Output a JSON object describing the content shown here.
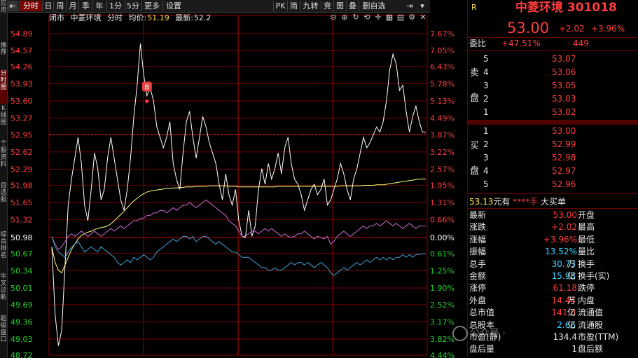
{
  "sidebar": {
    "tabs": [
      "应用",
      "推荐",
      "分时图",
      "K线图",
      "个股资料",
      "自选股",
      "综合排名",
      "牛叉诊断",
      "超级盘口"
    ]
  },
  "toolbar": {
    "left_icon": "back-arrow-icon",
    "periods": [
      "分时",
      "日",
      "周",
      "月",
      "季",
      "年",
      "1分",
      "5分",
      "更多",
      "设置"
    ],
    "active_period": "分时",
    "tools": [
      "PK",
      "简",
      "九转",
      "竞",
      "图",
      "叠",
      "删自选"
    ]
  },
  "chart_info": {
    "status": "闭市",
    "name": "中菱环境",
    "mode": "分时",
    "avg_label": "均价:",
    "avg_value": "51.19",
    "last_label": "最新:",
    "last_value": "52.2"
  },
  "colors": {
    "up": "#ff3c3c",
    "down": "#25d02a",
    "price_line": "#ffffff",
    "avg_line": "#ffff80",
    "magenta_line": "#cc6bd0",
    "blue_line": "#3aa0d6",
    "grid": "#8b0000"
  },
  "chart_data": {
    "type": "line",
    "prev_close": 50.98,
    "ylim": [
      48.72,
      55.24
    ],
    "y_ticks_left": [
      "54.89",
      "54.57",
      "54.26",
      "53.93",
      "53.60",
      "53.27",
      "52.95",
      "52.62",
      "52.29",
      "51.98",
      "51.65",
      "51.32",
      "50.98",
      "50.67",
      "50.34",
      "50.01",
      "49.69",
      "49.36",
      "49.03",
      "48.72"
    ],
    "y_ticks_right": [
      "7.67%",
      "7.05%",
      "6.43%",
      "5.78%",
      "5.13%",
      "4.49%",
      "3.87%",
      "3.22%",
      "2.57%",
      "1.95%",
      "1.31%",
      "0.66%",
      "0.00%",
      "0.61%",
      "1.25%",
      "1.90%",
      "2.52%",
      "3.17%",
      "3.82%",
      "4.44%"
    ],
    "marker": {
      "label": "B",
      "index": 29
    },
    "series": [
      {
        "values": [
          50.8,
          49.5,
          48.9,
          49.2,
          50.4,
          51.6,
          52.1,
          52.5,
          52.9,
          52.4,
          51.6,
          51.3,
          51.9,
          52.6,
          52.3,
          51.7,
          51.9,
          52.5,
          52.9,
          52.5,
          52.1,
          51.7,
          51.5,
          51.9,
          52.5,
          53.3,
          53.9,
          54.7,
          54.1,
          53.7,
          53.85,
          53.6,
          53.1,
          52.9,
          52.7,
          52.9,
          53.2,
          52.4,
          52.1,
          51.9,
          52.6,
          53.2,
          53.4,
          52.9,
          52.5,
          52.9,
          53.3,
          53.1,
          52.8,
          52.6,
          52.4,
          52.0,
          51.7,
          52.2,
          51.8,
          51.6,
          51.9,
          51.3,
          51.0,
          50.98,
          51.5,
          51.0,
          51.2,
          51.9,
          52.3,
          52.0,
          52.4,
          52.1,
          52.3,
          52.6,
          52.2,
          52.7,
          52.9,
          52.4,
          52.1,
          52.0,
          51.8,
          51.5,
          51.7,
          51.9,
          52.0,
          51.8,
          51.9,
          52.1,
          51.6,
          51.7,
          51.9,
          52.1,
          52.4,
          52.2,
          51.9,
          51.7,
          52.1,
          52.3,
          52.6,
          52.9,
          52.7,
          52.8,
          52.95,
          53.1,
          53.0,
          53.2,
          53.6,
          54.2,
          54.5,
          54.3,
          53.8,
          53.9,
          53.4,
          53.0,
          53.3,
          53.5,
          53.2,
          53.0,
          53.0
        ]
      },
      {
        "values": [
          50.8,
          50.5,
          50.35,
          50.3,
          50.45,
          50.6,
          50.75,
          50.85,
          50.95,
          51.02,
          51.05,
          51.08,
          51.1,
          51.13,
          51.15,
          51.17,
          51.18,
          51.2,
          51.24,
          51.3,
          51.36,
          51.42,
          51.48,
          51.55,
          51.62,
          51.68,
          51.73,
          51.78,
          51.82,
          51.85,
          51.87,
          51.88,
          51.89,
          51.9,
          51.91,
          51.92,
          51.92,
          51.93,
          51.93,
          51.94,
          51.94,
          51.95,
          51.95,
          51.95,
          51.96,
          51.96,
          51.96,
          51.96,
          51.97,
          51.97,
          51.97,
          51.97,
          51.97,
          51.97,
          51.96,
          51.96,
          51.96,
          51.95,
          51.95,
          51.95,
          51.95,
          51.95,
          51.95,
          51.95,
          51.95,
          51.95,
          51.95,
          51.95,
          51.95,
          51.96,
          51.96,
          51.96,
          51.96,
          51.96,
          51.96,
          51.96,
          51.96,
          51.96,
          51.96,
          51.96,
          51.96,
          51.96,
          51.96,
          51.96,
          51.96,
          51.96,
          51.96,
          51.96,
          51.97,
          51.97,
          51.97,
          51.97,
          51.97,
          51.97,
          51.97,
          51.98,
          51.98,
          51.98,
          51.98,
          51.99,
          51.99,
          51.99,
          52.0,
          52.01,
          52.02,
          52.03,
          52.04,
          52.05,
          52.06,
          52.07,
          52.08,
          52.09,
          52.1,
          52.1,
          52.1
        ]
      },
      {
        "values": [
          51.0,
          50.85,
          50.75,
          50.8,
          50.9,
          51.0,
          51.05,
          51.0,
          51.05,
          51.1,
          51.05,
          51.0,
          51.05,
          51.1,
          51.05,
          51.0,
          51.05,
          51.1,
          51.15,
          51.1,
          51.15,
          51.2,
          51.15,
          51.2,
          51.25,
          51.3,
          51.3,
          51.35,
          51.35,
          51.4,
          51.4,
          51.45,
          51.45,
          51.5,
          51.5,
          51.45,
          51.5,
          51.55,
          51.5,
          51.55,
          51.6,
          51.6,
          51.65,
          51.6,
          51.55,
          51.6,
          51.65,
          51.7,
          51.65,
          51.6,
          51.55,
          51.5,
          51.45,
          51.4,
          51.3,
          51.25,
          51.2,
          51.1,
          51.0,
          51.0,
          51.05,
          51.1,
          51.1,
          51.05,
          51.1,
          51.15,
          51.1,
          51.15,
          51.1,
          51.05,
          51.0,
          51.05,
          51.0,
          50.98,
          51.0,
          51.05,
          51.05,
          51.1,
          51.05,
          51.0,
          50.95,
          51.0,
          50.98,
          50.95,
          51.0,
          50.85,
          50.9,
          51.0,
          51.05,
          51.1,
          51.05,
          51.0,
          51.05,
          51.1,
          51.15,
          51.2,
          51.15,
          51.2,
          51.2,
          51.25,
          51.2,
          51.25,
          51.3,
          51.25,
          51.2,
          51.25,
          51.2,
          51.15,
          51.2,
          51.25,
          51.2,
          51.15,
          51.2,
          51.2,
          51.2
        ]
      },
      {
        "values": [
          51.0,
          50.8,
          50.7,
          50.65,
          50.6,
          50.7,
          50.8,
          50.85,
          50.9,
          50.8,
          50.7,
          50.75,
          50.8,
          50.75,
          50.7,
          50.8,
          50.75,
          50.7,
          50.65,
          50.6,
          50.5,
          50.45,
          50.5,
          50.55,
          50.5,
          50.6,
          50.55,
          50.6,
          50.65,
          50.6,
          50.55,
          50.6,
          50.7,
          50.75,
          50.8,
          50.85,
          50.9,
          50.95,
          50.9,
          50.95,
          51.0,
          51.0,
          50.95,
          51.0,
          50.9,
          50.95,
          51.0,
          51.0,
          50.95,
          50.9,
          50.85,
          50.9,
          50.85,
          50.8,
          50.75,
          50.7,
          50.7,
          50.65,
          50.6,
          50.6,
          50.6,
          50.55,
          50.5,
          50.45,
          50.4,
          50.4,
          50.35,
          50.35,
          50.4,
          50.35,
          50.35,
          50.4,
          50.45,
          50.5,
          50.45,
          50.5,
          50.5,
          50.45,
          50.5,
          50.45,
          50.4,
          50.45,
          50.5,
          50.45,
          50.4,
          50.3,
          50.25,
          50.3,
          50.35,
          50.4,
          50.35,
          50.4,
          50.45,
          50.5,
          50.45,
          50.5,
          50.55,
          50.5,
          50.55,
          50.6,
          50.55,
          50.6,
          50.55,
          50.6,
          50.55,
          50.6,
          50.6,
          50.65,
          50.6,
          50.65,
          50.6,
          50.65,
          50.65,
          50.67,
          50.67
        ]
      }
    ]
  },
  "quote": {
    "market_flag": "R",
    "title": "中菱环境 301018",
    "price": "53.00",
    "change": "+2.02",
    "change_pct": "+3.96%",
    "weibi_label": "委比",
    "weibi_value": "+47.51%",
    "weicha_value": "449",
    "sell_label": [
      "卖",
      "盘"
    ],
    "buy_label": [
      "买",
      "盘"
    ],
    "sell_levels": [
      {
        "n": "5",
        "price": "53.07"
      },
      {
        "n": "4",
        "price": "53.06"
      },
      {
        "n": "3",
        "price": "53.05"
      },
      {
        "n": "2",
        "price": "53.03"
      },
      {
        "n": "1",
        "price": "53.02"
      }
    ],
    "buy_levels": [
      {
        "n": "1",
        "price": "53.00"
      },
      {
        "n": "2",
        "price": "52.99"
      },
      {
        "n": "3",
        "price": "52.98"
      },
      {
        "n": "4",
        "price": "52.97"
      },
      {
        "n": "5",
        "price": "52.96"
      }
    ],
    "big_order": {
      "price": "53.13",
      "unit": "元有",
      "qty": "****手",
      "label": "大买单"
    },
    "stats_left": [
      {
        "label": "最新",
        "value": "53.00",
        "unit": ""
      },
      {
        "label": "涨跌",
        "value": "+2.02",
        "unit": ""
      },
      {
        "label": "涨幅",
        "value": "+3.96%",
        "unit": ""
      },
      {
        "label": "振幅",
        "value": "13.52%",
        "unit": ""
      },
      {
        "label": "总手",
        "value": "30.73",
        "unit": "万"
      },
      {
        "label": "金额",
        "value": "15.98",
        "unit": "亿"
      },
      {
        "label": "涨停",
        "value": "61.18",
        "unit": ""
      },
      {
        "label": "外盘",
        "value": "14.44",
        "unit": "万"
      },
      {
        "label": "总市值",
        "value": "141.0",
        "unit": "亿"
      },
      {
        "label": "总股本",
        "value": "2.66",
        "unit": "亿"
      },
      {
        "label": "市盈(静)",
        "value": "134.4",
        "unit": ""
      },
      {
        "label": "盘后量",
        "value": "1",
        "unit": ""
      }
    ],
    "stats_right": [
      "开盘",
      "最高",
      "最低",
      "量比",
      "换手",
      "换手(实)",
      "跌停",
      "内盘",
      "流通值",
      "流通股",
      "市盈(TTM)",
      "盘后额"
    ]
  },
  "watermark": "公众号 ·"
}
